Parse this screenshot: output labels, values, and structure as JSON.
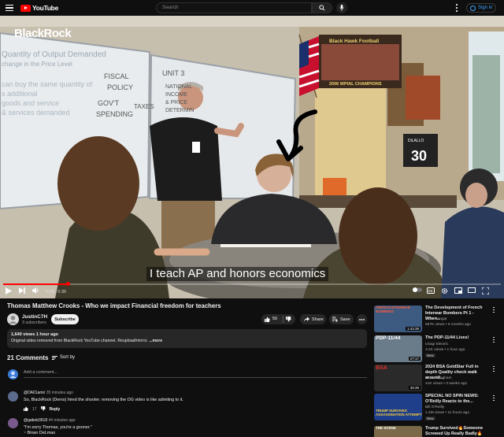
{
  "header": {
    "logo_text": "YouTube",
    "search_placeholder": "Search",
    "signin_label": "Sign in"
  },
  "video": {
    "brand_overlay": "BlackRock",
    "caption": "I teach AP and honors economics",
    "time_display": "0:04 / 0:30",
    "progress_fraction": 0.13,
    "whiteboard_text": [
      "Quantity of Output Demanded",
      "change in the Price Level",
      "can buy the same quantity of",
      "s additional",
      "goods and service",
      "& services demanded",
      "FISCAL",
      "POLICY",
      "GOV'T",
      "SPENDING",
      "TAXES",
      "UNIT 3",
      "NATIONAL",
      "INCOME",
      "& PRICE",
      "DETERMIN"
    ],
    "poster_text": [
      "Black Hawk Football",
      "2006 WPIAL CHAMPIONS"
    ],
    "jersey_text": [
      "DiLALLO",
      "30"
    ]
  },
  "info": {
    "title": "Thomas Matthew Crooks - Who we impact Financial freedom for teachers",
    "channel_name": "JustinC7H",
    "subscribers": "3 subscribers",
    "subscribe_label": "Subscribe",
    "like_count": "56",
    "share_label": "Share",
    "save_label": "Save"
  },
  "description": {
    "meta": "1,640 views  1 hour ago",
    "text": "Original video removed from BlackRock YouTube channel.  Reupload/mirror. ",
    "more_label": "...more"
  },
  "comments": {
    "count_label": "21 Comments",
    "sort_label": "Sort by",
    "add_placeholder": "Add a comment...",
    "items": [
      {
        "author": "@DA01amir",
        "ago": "35 minutes ago",
        "text": "So, BlackRock (Dems) hired the shooter. removing the OG video is like admiting to it.",
        "likes": "17",
        "reply_label": "Reply",
        "avatar_color": "#5a6b8c"
      },
      {
        "author": "@gabob3618",
        "ago": "44 minutes ago",
        "text": "\"I'm sorry Thomas, you're a gooner.\"",
        "text2": "~ Binan DeLmao",
        "avatar_color": "#7a5a8c"
      }
    ]
  },
  "related": [
    {
      "title": "The Development of French Interwar Bombers Pt 1 - When...",
      "channel": "Ikoi's Hangar",
      "meta": "657K views • 6 months ago",
      "duration": "1:43:39",
      "thumb_text": "FRENCH INTERWAR BOMBERS",
      "thumb_color": "#3d5a80"
    },
    {
      "title": "The PDP-11/44 Lives!",
      "channel": "Usagi Electric",
      "meta": "3.2K views • 1 hour ago",
      "badge": "New",
      "duration": "27:17",
      "thumb_text": "PDP-11/44",
      "thumb_color": "#6a7b8a"
    },
    {
      "title": "2024 BSA GoldStar Full in depth Quality check walk around...",
      "channel": "stuart fillingham",
      "meta": "41K views • 3 weeks ago",
      "duration": "39:39",
      "thumb_text": "BSA",
      "thumb_color": "#2a2a2a"
    },
    {
      "title": "SPECIAL NO SPIN NEWS: O'Reilly Reacts to the...",
      "channel": "Bill O'Reilly",
      "meta": "1.2M views • 11 hours ago",
      "badge": "New",
      "duration": "",
      "thumb_text": "TRUMP SURVIVES ASSASSINATION ATTEMPT",
      "thumb_color": "#1f3f8a"
    },
    {
      "title": "Trump Survived🔥Someone Screwed Up Really Badly🔥FA...",
      "channel": "",
      "meta": "",
      "duration": "",
      "thumb_text": "THE SCENE",
      "thumb_color": "#7a6a4a"
    }
  ]
}
